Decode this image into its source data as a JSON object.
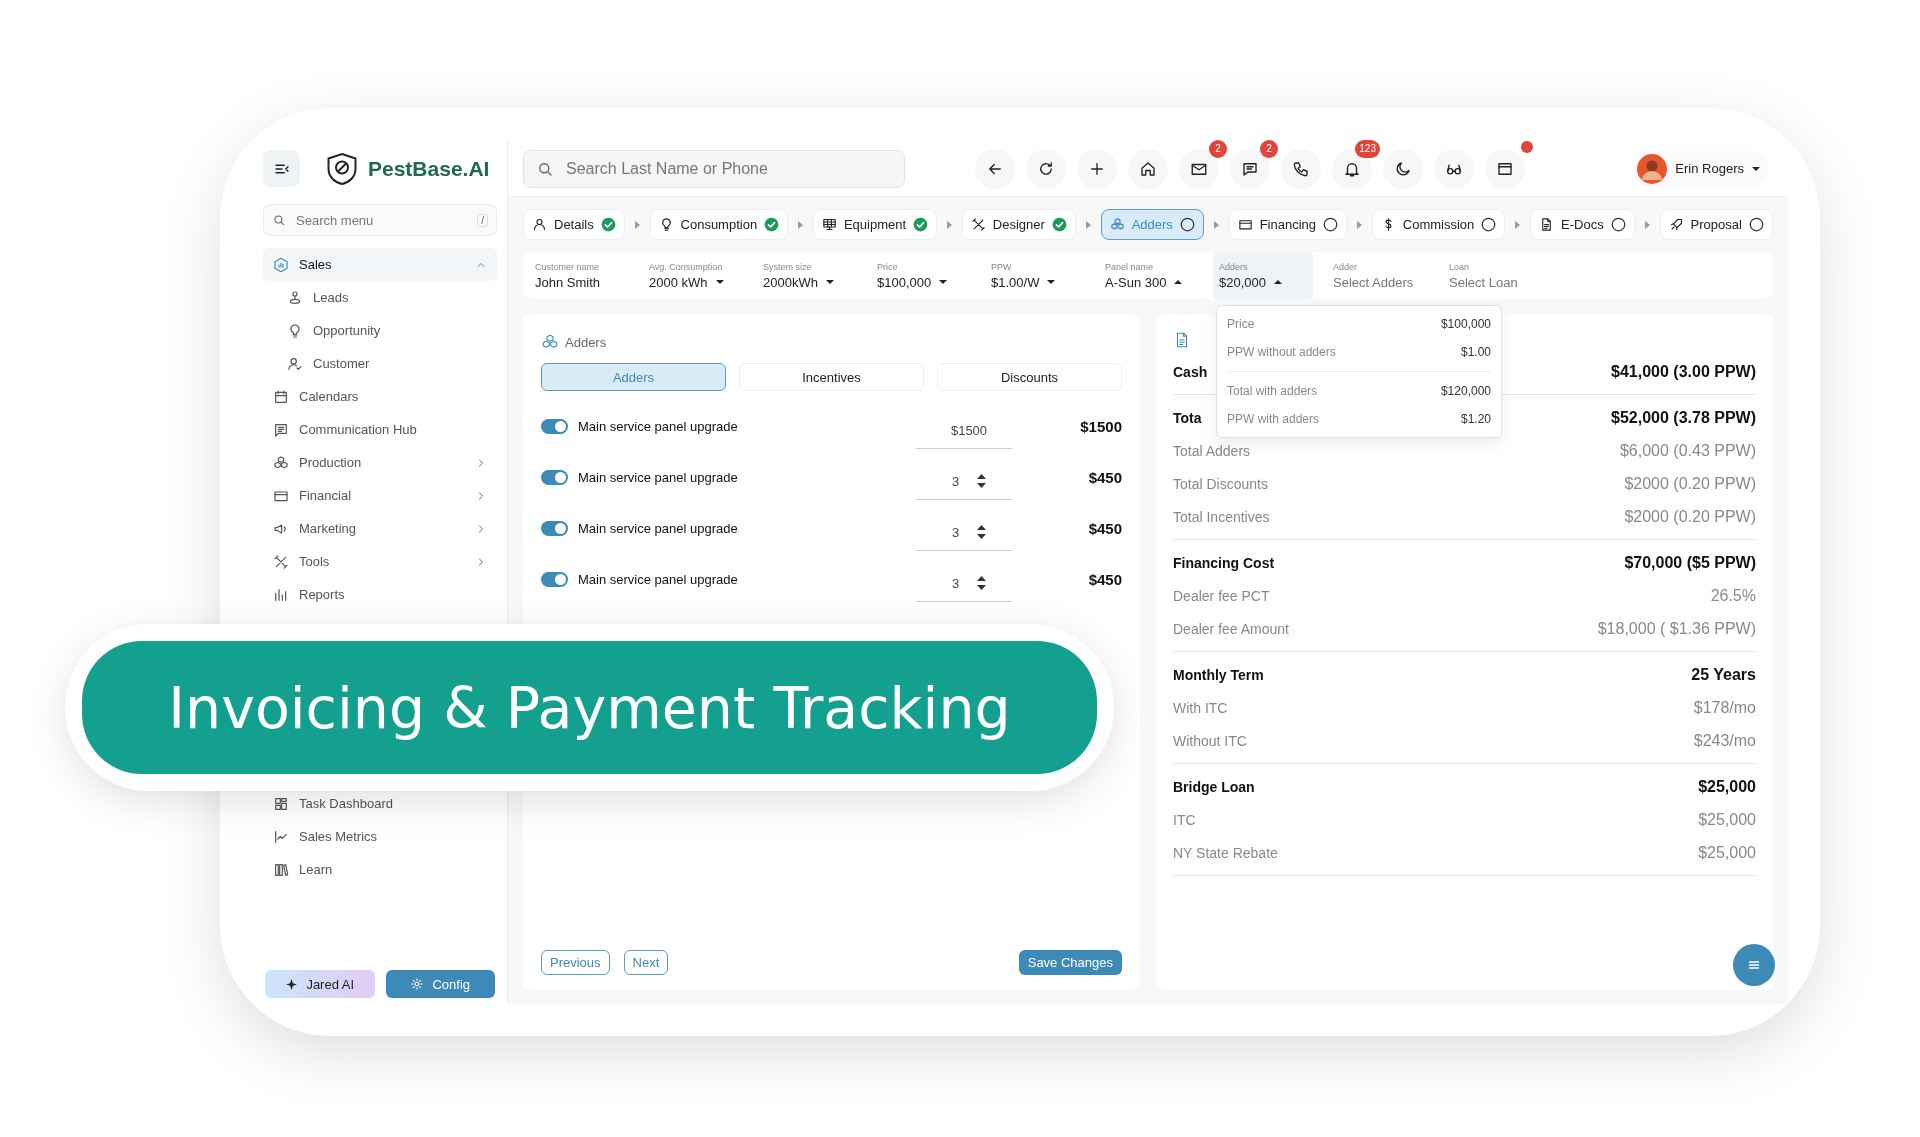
{
  "sidebar": {
    "brand": "PestBase.AI",
    "search": {
      "placeholder": "Search menu",
      "shortcut": "/"
    },
    "items": [
      {
        "label": "Sales",
        "selected": true,
        "expanded": true,
        "children": [
          {
            "label": "Leads",
            "selected": false
          },
          {
            "label": "Opportunity",
            "selected": false
          },
          {
            "label": "Customer",
            "selected": false
          }
        ]
      },
      {
        "label": "Calendars",
        "selected": false
      },
      {
        "label": "Communication Hub",
        "selected": false
      },
      {
        "label": "Production",
        "selected": false,
        "expanded": false
      },
      {
        "label": "Financial",
        "selected": false,
        "expanded": false
      },
      {
        "label": "Marketing",
        "selected": false,
        "expanded": false
      },
      {
        "label": "Tools",
        "selected": false,
        "expanded": false
      },
      {
        "label": "Reports",
        "selected": false
      }
    ],
    "lower_items": [
      {
        "label": "Task Dashboard",
        "selected": false
      },
      {
        "label": "Sales Metrics",
        "selected": false
      },
      {
        "label": "Learn",
        "selected": false
      }
    ],
    "buttons": [
      {
        "label": "Jared AI",
        "kind": "ai"
      },
      {
        "label": "Config",
        "kind": "primary"
      }
    ]
  },
  "header": {
    "search": {
      "placeholder": "Search Last Name or Phone"
    },
    "actions": [
      {
        "kind": "back"
      },
      {
        "kind": "refresh"
      },
      {
        "kind": "add"
      },
      {
        "kind": "home"
      },
      {
        "kind": "mail",
        "badge": "2"
      },
      {
        "kind": "chat",
        "badge": "2"
      },
      {
        "kind": "phone"
      },
      {
        "kind": "bell",
        "badge": "123"
      },
      {
        "kind": "moon"
      },
      {
        "kind": "glasses"
      },
      {
        "kind": "window",
        "alert": true
      }
    ],
    "user": {
      "name": "Erin Rogers"
    }
  },
  "steps": [
    {
      "label": "Details",
      "done": true,
      "selected": false
    },
    {
      "label": "Consumption",
      "done": true,
      "selected": false
    },
    {
      "label": "Equipment",
      "done": true,
      "selected": false
    },
    {
      "label": "Designer",
      "done": true,
      "selected": false
    },
    {
      "label": "Adders",
      "done": false,
      "selected": true
    },
    {
      "label": "Financing",
      "done": false,
      "selected": false
    },
    {
      "label": "Commission",
      "done": false,
      "selected": false
    },
    {
      "label": "E-Docs",
      "done": false,
      "selected": false
    },
    {
      "label": "Proposal",
      "done": false,
      "selected": false
    }
  ],
  "info_fields": [
    {
      "label": "Customer name",
      "value": "John Smith",
      "selected": false
    },
    {
      "label": "Avg. Consumption",
      "value": "2000 kWh",
      "open": false,
      "selected": false
    },
    {
      "label": "System size",
      "value": "2000kWh",
      "open": false,
      "selected": false
    },
    {
      "label": "Price",
      "value": "$100,000",
      "open": false,
      "selected": false
    },
    {
      "label": "PPW",
      "value": "$1.00/W",
      "open": false,
      "selected": false
    },
    {
      "label": "Panel name",
      "value": "A-Sun 300",
      "open": true,
      "selected": false
    },
    {
      "label": "Adders",
      "value": "$20,000",
      "open": true,
      "selected": true
    },
    {
      "label": "Adder",
      "placeholder": "Select Adders",
      "selected": false
    },
    {
      "label": "Loan",
      "placeholder": "Select Loan",
      "selected": false
    }
  ],
  "price_popover": {
    "groups": [
      [
        {
          "label": "Price",
          "value": "$100,000"
        },
        {
          "label": "PPW without adders",
          "value": "$1.00"
        }
      ],
      [
        {
          "label": "Total with adders",
          "value": "$120,000"
        },
        {
          "label": "PPW with adders",
          "value": "$1.20"
        }
      ]
    ]
  },
  "adders_panel": {
    "title": "Adders",
    "tabs": [
      {
        "label": "Adders",
        "selected": true
      },
      {
        "label": "Incentives",
        "selected": false
      },
      {
        "label": "Discounts",
        "selected": false
      }
    ],
    "rows": [
      {
        "on": true,
        "label": "Main service panel upgrade",
        "kind": "price",
        "input": "$1500",
        "amount": "$1500"
      },
      {
        "on": true,
        "label": "Main service panel upgrade",
        "kind": "quantity",
        "input": "3",
        "amount": "$450"
      },
      {
        "on": true,
        "label": "Main service panel upgrade",
        "kind": "quantity",
        "input": "3",
        "amount": "$450"
      },
      {
        "on": true,
        "label": "Main service panel upgrade",
        "kind": "quantity",
        "input": "3",
        "amount": "$450"
      }
    ],
    "buttons": [
      {
        "label": "Previous",
        "kind": "outline"
      },
      {
        "label": "Next",
        "kind": "outline"
      },
      {
        "label": "Save Changes",
        "kind": "primary"
      }
    ]
  },
  "summary_panel": {
    "sections": [
      {
        "rows": [
          {
            "label": "Cash",
            "value": "$41,000 (3.00 PPW)",
            "kind": "total"
          }
        ]
      },
      {
        "rows": [
          {
            "label": "Tota",
            "value": "$52,000 (3.78 PPW)",
            "kind": "total"
          },
          {
            "label": "Total Adders",
            "value": "$6,000 (0.43 PPW)",
            "kind": "detail"
          },
          {
            "label": "Total Discounts",
            "value": "$2000 (0.20 PPW)",
            "kind": "detail"
          },
          {
            "label": "Total Incentives",
            "value": "$2000 (0.20 PPW)",
            "kind": "detail"
          }
        ]
      },
      {
        "rows": [
          {
            "label": "Financing Cost",
            "value": "$70,000 ($5 PPW)",
            "kind": "total"
          },
          {
            "label": "Dealer fee PCT",
            "value": "26.5%",
            "kind": "detail"
          },
          {
            "label": "Dealer fee Amount",
            "value": "$18,000 ( $1.36 PPW)",
            "kind": "detail"
          }
        ]
      },
      {
        "rows": [
          {
            "label": "Monthly Term",
            "value": "25 Years",
            "kind": "total"
          },
          {
            "label": "With ITC",
            "value": "$178/mo",
            "kind": "detail"
          },
          {
            "label": "Without ITC",
            "value": "$243/mo",
            "kind": "detail"
          }
        ]
      },
      {
        "rows": [
          {
            "label": "Bridge Loan",
            "value": "$25,000",
            "kind": "total"
          },
          {
            "label": "ITC",
            "value": "$25,000",
            "kind": "detail"
          },
          {
            "label": "NY State Rebate",
            "value": "$25,000",
            "kind": "detail"
          }
        ]
      }
    ]
  },
  "banner": {
    "text": "Invoicing & Payment Tracking"
  }
}
